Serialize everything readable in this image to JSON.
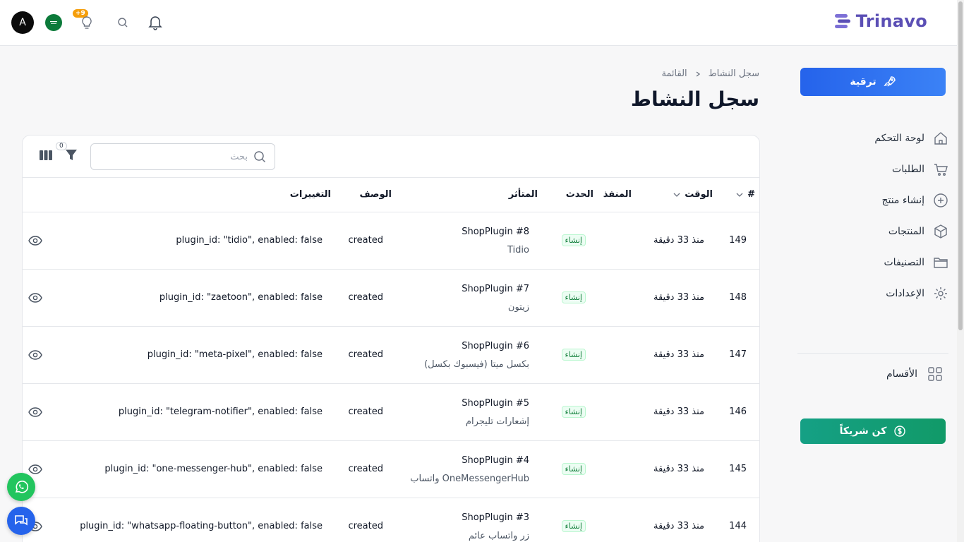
{
  "brand": {
    "name": "Trinavo"
  },
  "topbar": {
    "avatar_letter": "A",
    "notifications_badge": "+9"
  },
  "sidebar": {
    "upgrade_label": "ترقية",
    "items": [
      {
        "label": "لوحة التحكم",
        "icon": "home-icon"
      },
      {
        "label": "الطلبات",
        "icon": "cart-icon"
      },
      {
        "label": "إنشاء منتج",
        "icon": "plus-circle-icon"
      },
      {
        "label": "المنتجات",
        "icon": "box-icon"
      },
      {
        "label": "التصنيفات",
        "icon": "folder-icon"
      },
      {
        "label": "الإعدادات",
        "icon": "gear-icon"
      }
    ],
    "sections_label": "الأقسام",
    "partner_label": "كن شريكاً"
  },
  "breadcrumb": {
    "current": "سجل النشاط",
    "parent": "القائمة"
  },
  "page": {
    "title": "سجل النشاط"
  },
  "table": {
    "search_placeholder": "بحث",
    "filter_count": "0",
    "headers": {
      "id": "#",
      "time": "الوقت",
      "causer": "المنفذ",
      "event": "الحدث",
      "subject": "المتأثر",
      "description": "الوصف",
      "changes": "التغييرات"
    },
    "rows": [
      {
        "id": "149",
        "time": "منذ 33 دقيقة",
        "event": "إنشاء",
        "subject": "ShopPlugin #8",
        "subject_sub": "Tidio",
        "description": "created",
        "changes": "plugin_id: \"tidio\", enabled: false"
      },
      {
        "id": "148",
        "time": "منذ 33 دقيقة",
        "event": "إنشاء",
        "subject": "ShopPlugin #7",
        "subject_sub": "زيتون",
        "description": "created",
        "changes": "plugin_id: \"zaetoon\", enabled: false"
      },
      {
        "id": "147",
        "time": "منذ 33 دقيقة",
        "event": "إنشاء",
        "subject": "ShopPlugin #6",
        "subject_sub": "بكسل ميتا (فيسبوك بكسل)",
        "description": "created",
        "changes": "plugin_id: \"meta-pixel\", enabled: false"
      },
      {
        "id": "146",
        "time": "منذ 33 دقيقة",
        "event": "إنشاء",
        "subject": "ShopPlugin #5",
        "subject_sub": "إشعارات تليجرام",
        "description": "created",
        "changes": "plugin_id: \"telegram-notifier\", enabled: false"
      },
      {
        "id": "145",
        "time": "منذ 33 دقيقة",
        "event": "إنشاء",
        "subject": "ShopPlugin #4",
        "subject_sub": "واتساب OneMessengerHub",
        "description": "created",
        "changes": "plugin_id: \"one-messenger-hub\", enabled: false"
      },
      {
        "id": "144",
        "time": "منذ 33 دقيقة",
        "event": "إنشاء",
        "subject": "ShopPlugin #3",
        "subject_sub": "زر واتساب عائم",
        "description": "created",
        "changes": "plugin_id: \"whatsapp-floating-button\", enabled: false"
      }
    ]
  },
  "colors": {
    "primary": "#2563eb",
    "success": "#119a68",
    "brand": "#5b4fb5"
  }
}
